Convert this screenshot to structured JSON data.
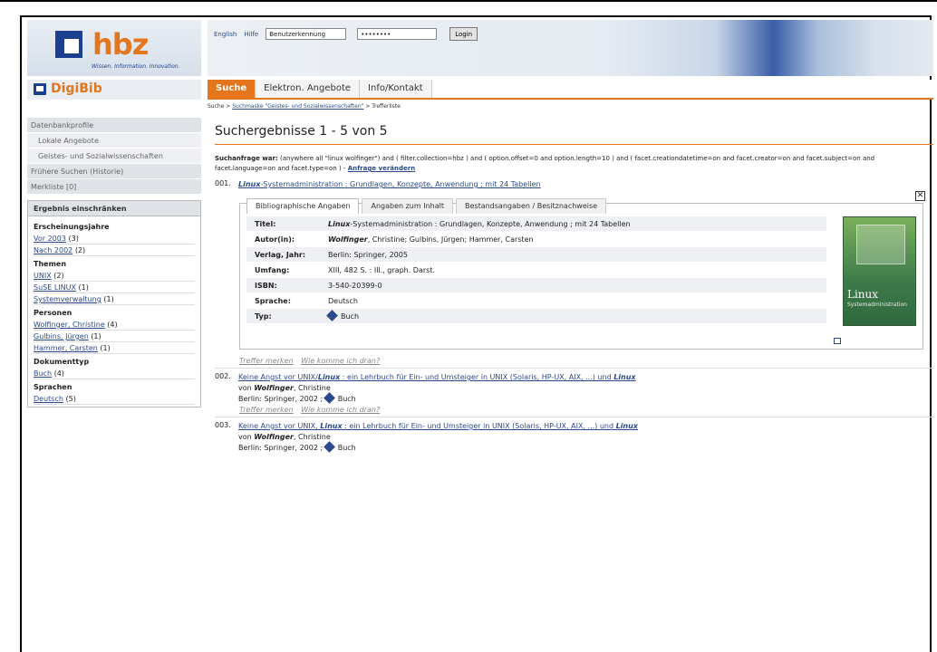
{
  "header": {
    "logo_text": "hbz",
    "logo_tagline": "Wissen. Information. Innovation.",
    "links": [
      "English",
      "Hilfe"
    ],
    "username_value": "Benutzerkennung",
    "password_value": "••••••••",
    "login_label": "Login"
  },
  "brand": {
    "name": "DigiBib"
  },
  "tabs": [
    {
      "label": "Suche",
      "active": true
    },
    {
      "label": "Elektron. Angebote",
      "active": false
    },
    {
      "label": "Info/Kontakt",
      "active": false
    }
  ],
  "breadcrumb": {
    "first": "Suche",
    "link": "Suchmaske \"Geistes- und Sozialwissenschaften\"",
    "last": "Trefferliste"
  },
  "sidebar": {
    "items": [
      {
        "label": "Datenbankprofile"
      },
      {
        "label": "Lokale Angebote"
      },
      {
        "label": "Geistes- und Sozialwissenschaften"
      },
      {
        "label": "Frühere Suchen (Historie)"
      },
      {
        "label": "Merkliste [0]"
      }
    ],
    "filter_title": "Ergebnis einschränken",
    "groups": [
      {
        "heading": "Erscheinungsjahre",
        "entries": [
          {
            "label": "Vor 2003",
            "count": "(3)"
          },
          {
            "label": "Nach 2002",
            "count": "(2)"
          }
        ]
      },
      {
        "heading": "Themen",
        "entries": [
          {
            "label": "UNIX",
            "count": "(2)"
          },
          {
            "label": "SuSE LINUX",
            "count": "(1)"
          },
          {
            "label": "Systemverwaltung",
            "count": "(1)"
          }
        ]
      },
      {
        "heading": "Personen",
        "entries": [
          {
            "label": "Wolfinger, Christine",
            "count": "(4)"
          },
          {
            "label": "Gulbins, Jürgen",
            "count": "(1)"
          },
          {
            "label": "Hammer, Carsten",
            "count": "(1)"
          }
        ]
      },
      {
        "heading": "Dokumenttyp",
        "entries": [
          {
            "label": "Buch",
            "count": "(4)"
          }
        ]
      },
      {
        "heading": "Sprachen",
        "entries": [
          {
            "label": "Deutsch",
            "count": "(5)"
          }
        ]
      }
    ]
  },
  "main": {
    "title": "Suchergebnisse 1 - 5 von 5",
    "query_label": "Suchanfrage war:",
    "query_text": " (anywhere all \"linux wolfinger\") and ( filter.collection=hbz ) and ( option.offset=0 and option.length=10 ) and ( facet.creationdatetime=on and facet.creator=on and facet.subject=on and facet.language=on and facet.type=on ) - ",
    "query_modify": "Anfrage verändern",
    "hits": [
      {
        "num": "001.",
        "title_em": "Linux",
        "title_rest": "-Systemadministration : Grundlagen, Konzepte, Anwendung ; mit 24 Tabellen"
      },
      {
        "num": "002.",
        "title_pre": "Keine Angst vor UNIX/",
        "title_em": "Linux",
        "title_mid": " : ein Lehrbuch für Ein- und Umsteiger in UNIX (Solaris, HP-UX, AIX, ...) und ",
        "title_em2": "Linux",
        "author_pre": "von ",
        "author": "Wolfinger",
        "author_rest": ", Christine",
        "pub": "Berlin: Springer, 2002 ; ",
        "type": "Buch"
      },
      {
        "num": "003.",
        "title_pre": "Keine Angst vor UNIX, ",
        "title_em": "Linux",
        "title_mid": " : ein Lehrbuch für Ein- und Umsteiger in UNIX (Solaris, HP-UX, AIX, ...) und ",
        "title_em2": "Linux",
        "author_pre": "von ",
        "author": "Wolfinger",
        "author_rest": ", Christine",
        "pub": "Berlin: Springer, 2002 ; ",
        "type": "Buch"
      }
    ],
    "detail_tabs": [
      "Bibliographische Angaben",
      "Angaben zum Inhalt",
      "Bestandsangaben / Besitznachweise"
    ],
    "detail": {
      "titel_k": "Titel:",
      "titel_em": "Linux",
      "titel_v": "-Systemadministration : Grundlagen, Konzepte, Anwendung ; mit 24 Tabellen",
      "autor_k": "Autor(in):",
      "autor_em": "Wolfinger",
      "autor_v": ", Christine; Gulbins, Jürgen; Hammer, Carsten",
      "verlag_k": "Verlag, Jahr:",
      "verlag_v": "Berlin: Springer, 2005",
      "umfang_k": "Umfang:",
      "umfang_v": "XIII, 482 S. : Ill., graph. Darst.",
      "isbn_k": "ISBN:",
      "isbn_v": "3-540-20399-0",
      "sprache_k": "Sprache:",
      "sprache_v": "Deutsch",
      "typ_k": "Typ:",
      "typ_v": "Buch"
    },
    "cover": {
      "title": "Linux",
      "subtitle": "Systemadministration"
    },
    "actions": {
      "mark": "Treffer merken",
      "howto": "Wie komme ich dran?"
    }
  },
  "colors": {
    "accent": "#e4761e",
    "brand_blue": "#1c3f8f",
    "link": "#2a4a8c"
  }
}
